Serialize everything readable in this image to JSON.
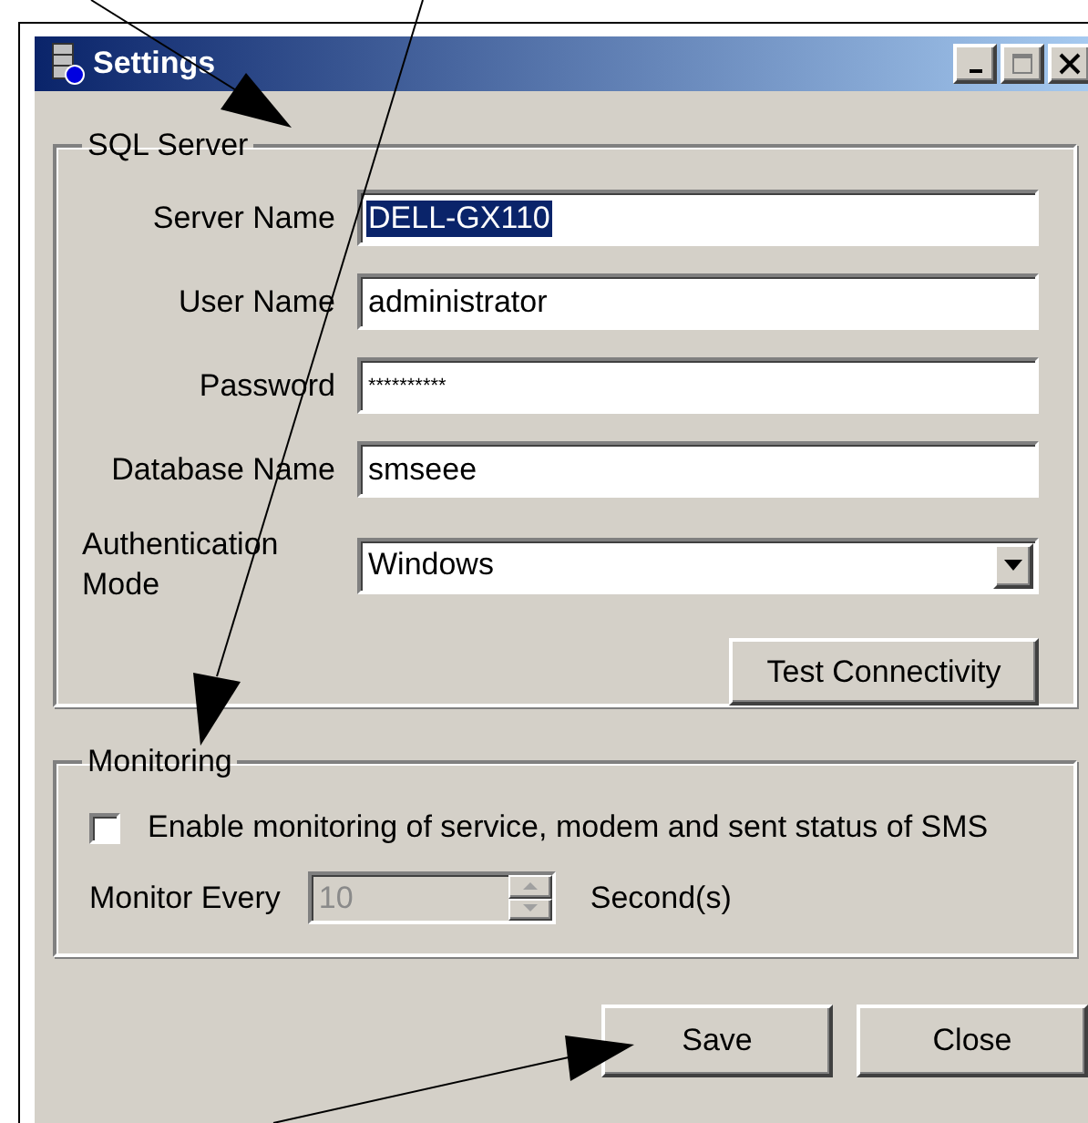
{
  "window": {
    "title": "Settings"
  },
  "sql_server": {
    "title": "SQL Server",
    "fields": [
      {
        "kind": "text",
        "label": "Server Name",
        "value": "DELL-GX110",
        "text_selected": true
      },
      {
        "kind": "text",
        "label": "User Name",
        "value": "administrator",
        "text_selected": false
      },
      {
        "kind": "password",
        "label": "Password",
        "value": "**********",
        "text_selected": false
      },
      {
        "kind": "text",
        "label": "Database Name",
        "value": "smseee",
        "text_selected": false
      },
      {
        "kind": "dropdown",
        "label": "Authentication Mode",
        "value": "Windows",
        "text_selected": false
      }
    ],
    "button": "Test Connectivity"
  },
  "monitoring": {
    "title": "Monitoring",
    "checkbox": {
      "label": "Enable monitoring of service, modem and sent status of SMS",
      "checked": false
    },
    "interval": {
      "label": "Monitor Every",
      "value": "10",
      "disabled": true,
      "unit": "Second(s)"
    }
  },
  "buttons": [
    "Save",
    "Close"
  ]
}
